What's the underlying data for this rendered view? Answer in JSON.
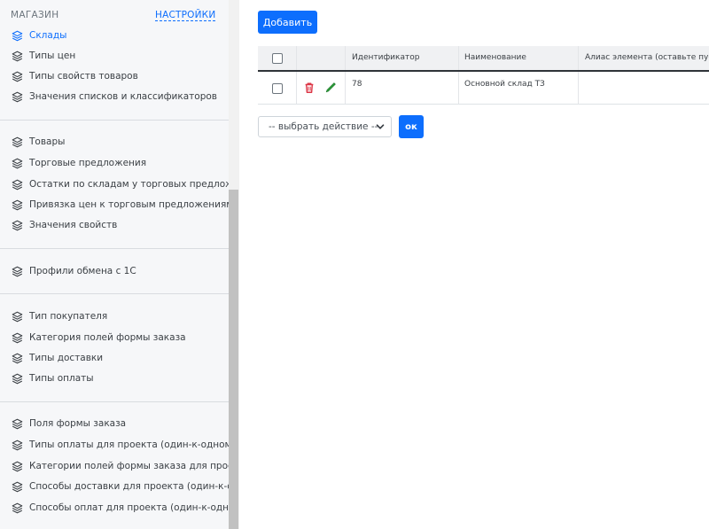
{
  "sidebar": {
    "section_title": "МАГАЗИН",
    "settings_link": "НАСТРОЙКИ",
    "groups": [
      [
        "Склады",
        "Типы цен",
        "Типы свойств товаров",
        "Значения списков и классификаторов"
      ],
      [
        "Товары",
        "Торговые предложения",
        "Остатки по складам у торговых предложений",
        "Привязка цен к торговым предложениям",
        "Значения свойств"
      ],
      [
        "Профили обмена с 1С"
      ],
      [
        "Тип покупателя",
        "Категория полей формы заказа",
        "Типы доставки",
        "Типы оплаты"
      ],
      [
        "Поля формы заказа",
        "Типы оплаты для проекта (один-к-одному)",
        "Категории полей формы заказа для проекта (один-к-одному)",
        "Способы доставки для проекта (один-к-одному)",
        "Способы оплат для проекта (один-к-одному)"
      ]
    ],
    "active_item": "Склады",
    "icon": "layers-icon"
  },
  "toolbar": {
    "add_label": "Добавить"
  },
  "table": {
    "columns": [
      "Идентификатор",
      "Наименование",
      "Алиас элемента (оставьте пустым)"
    ],
    "rows": [
      {
        "id": "78",
        "name": "Основной склад ТЗ",
        "alias": ""
      }
    ]
  },
  "bulk": {
    "action_placeholder": "-- выбрать действие --",
    "ok_label": "ок"
  },
  "colors": {
    "accent": "#0d6efd",
    "delete": "#dc3545",
    "edit": "#2e9e3c",
    "sidebar_bg": "#f6f7f9"
  }
}
